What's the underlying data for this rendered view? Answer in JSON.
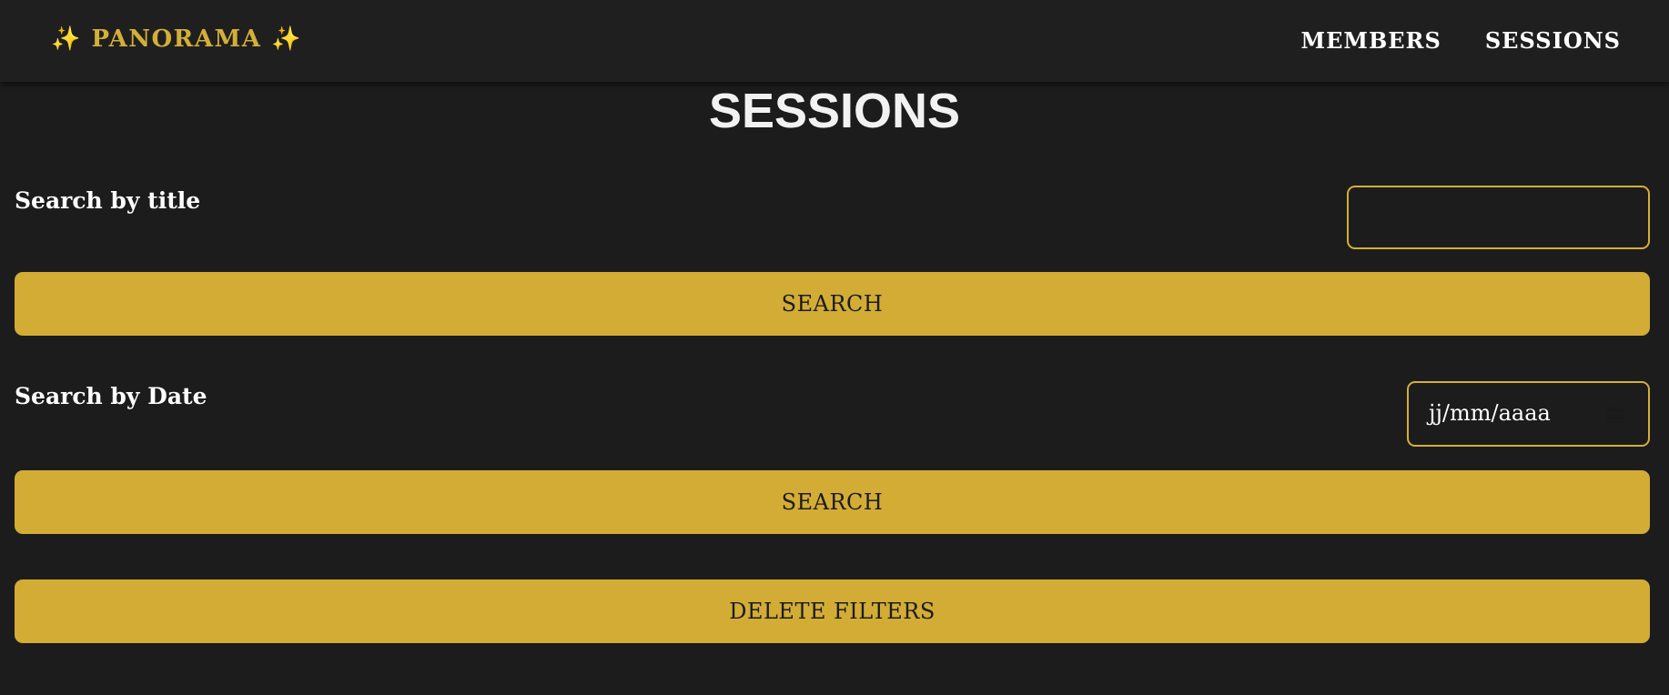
{
  "navbar": {
    "brand": {
      "sparkle_left": "✨",
      "name": "PANORAMA",
      "sparkle_right": "✨"
    },
    "links": [
      {
        "label": "MEMBERS"
      },
      {
        "label": "SESSIONS"
      }
    ]
  },
  "page": {
    "title": "SESSIONS"
  },
  "filters": {
    "title_search": {
      "label": "Search by title",
      "value": "",
      "button_label": "SEARCH"
    },
    "date_search": {
      "label": "Search by Date",
      "placeholder": "jj/mm/aaaa",
      "button_label": "SEARCH"
    },
    "delete_filters_label": "DELETE FILTERS"
  },
  "icons": {
    "calendar": "calendar-icon"
  },
  "colors": {
    "background": "#1c1c1c",
    "navbar": "#1f1f1f",
    "accent_gold": "#d4af37",
    "button_gold": "#d2ac35",
    "text": "#ffffff"
  }
}
